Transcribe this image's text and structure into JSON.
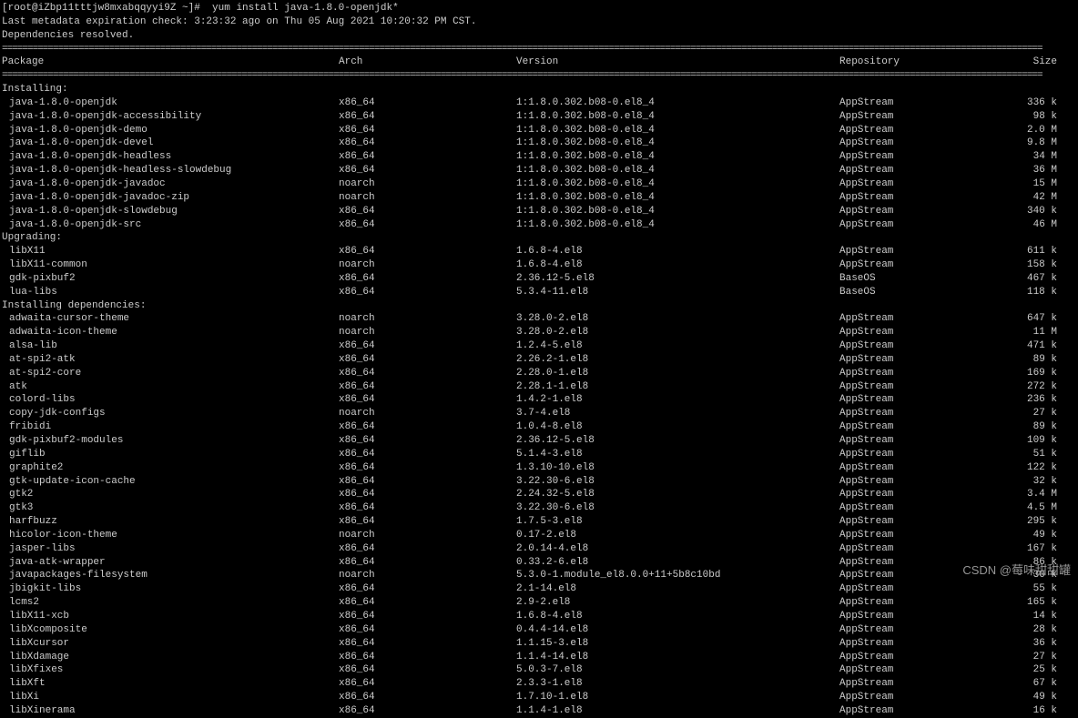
{
  "prompt": "[root@iZbp11tttjw8mxabqqyyi9Z ~]#  yum install java-1.8.0-openjdk*",
  "meta_line": "Last metadata expiration check: 3:23:32 ago on Thu 05 Aug 2021 10:20:32 PM CST.",
  "resolved_line": "Dependencies resolved.",
  "headers": {
    "package": "Package",
    "arch": "Arch",
    "version": "Version",
    "repo": "Repository",
    "size": "Size"
  },
  "sections": [
    {
      "label": "Installing:",
      "rows": [
        {
          "name": "java-1.8.0-openjdk",
          "arch": "x86_64",
          "version": "1:1.8.0.302.b08-0.el8_4",
          "repo": "AppStream",
          "size": "336 k"
        },
        {
          "name": "java-1.8.0-openjdk-accessibility",
          "arch": "x86_64",
          "version": "1:1.8.0.302.b08-0.el8_4",
          "repo": "AppStream",
          "size": "98 k"
        },
        {
          "name": "java-1.8.0-openjdk-demo",
          "arch": "x86_64",
          "version": "1:1.8.0.302.b08-0.el8_4",
          "repo": "AppStream",
          "size": "2.0 M"
        },
        {
          "name": "java-1.8.0-openjdk-devel",
          "arch": "x86_64",
          "version": "1:1.8.0.302.b08-0.el8_4",
          "repo": "AppStream",
          "size": "9.8 M"
        },
        {
          "name": "java-1.8.0-openjdk-headless",
          "arch": "x86_64",
          "version": "1:1.8.0.302.b08-0.el8_4",
          "repo": "AppStream",
          "size": "34 M"
        },
        {
          "name": "java-1.8.0-openjdk-headless-slowdebug",
          "arch": "x86_64",
          "version": "1:1.8.0.302.b08-0.el8_4",
          "repo": "AppStream",
          "size": "36 M"
        },
        {
          "name": "java-1.8.0-openjdk-javadoc",
          "arch": "noarch",
          "version": "1:1.8.0.302.b08-0.el8_4",
          "repo": "AppStream",
          "size": "15 M"
        },
        {
          "name": "java-1.8.0-openjdk-javadoc-zip",
          "arch": "noarch",
          "version": "1:1.8.0.302.b08-0.el8_4",
          "repo": "AppStream",
          "size": "42 M"
        },
        {
          "name": "java-1.8.0-openjdk-slowdebug",
          "arch": "x86_64",
          "version": "1:1.8.0.302.b08-0.el8_4",
          "repo": "AppStream",
          "size": "340 k"
        },
        {
          "name": "java-1.8.0-openjdk-src",
          "arch": "x86_64",
          "version": "1:1.8.0.302.b08-0.el8_4",
          "repo": "AppStream",
          "size": "46 M"
        }
      ]
    },
    {
      "label": "Upgrading:",
      "rows": [
        {
          "name": "libX11",
          "arch": "x86_64",
          "version": "1.6.8-4.el8",
          "repo": "AppStream",
          "size": "611 k"
        },
        {
          "name": "libX11-common",
          "arch": "noarch",
          "version": "1.6.8-4.el8",
          "repo": "AppStream",
          "size": "158 k"
        },
        {
          "name": "gdk-pixbuf2",
          "arch": "x86_64",
          "version": "2.36.12-5.el8",
          "repo": "BaseOS",
          "size": "467 k"
        },
        {
          "name": "lua-libs",
          "arch": "x86_64",
          "version": "5.3.4-11.el8",
          "repo": "BaseOS",
          "size": "118 k"
        }
      ]
    },
    {
      "label": "Installing dependencies:",
      "rows": [
        {
          "name": "adwaita-cursor-theme",
          "arch": "noarch",
          "version": "3.28.0-2.el8",
          "repo": "AppStream",
          "size": "647 k"
        },
        {
          "name": "adwaita-icon-theme",
          "arch": "noarch",
          "version": "3.28.0-2.el8",
          "repo": "AppStream",
          "size": "11 M"
        },
        {
          "name": "alsa-lib",
          "arch": "x86_64",
          "version": "1.2.4-5.el8",
          "repo": "AppStream",
          "size": "471 k"
        },
        {
          "name": "at-spi2-atk",
          "arch": "x86_64",
          "version": "2.26.2-1.el8",
          "repo": "AppStream",
          "size": "89 k"
        },
        {
          "name": "at-spi2-core",
          "arch": "x86_64",
          "version": "2.28.0-1.el8",
          "repo": "AppStream",
          "size": "169 k"
        },
        {
          "name": "atk",
          "arch": "x86_64",
          "version": "2.28.1-1.el8",
          "repo": "AppStream",
          "size": "272 k"
        },
        {
          "name": "colord-libs",
          "arch": "x86_64",
          "version": "1.4.2-1.el8",
          "repo": "AppStream",
          "size": "236 k"
        },
        {
          "name": "copy-jdk-configs",
          "arch": "noarch",
          "version": "3.7-4.el8",
          "repo": "AppStream",
          "size": "27 k"
        },
        {
          "name": "fribidi",
          "arch": "x86_64",
          "version": "1.0.4-8.el8",
          "repo": "AppStream",
          "size": "89 k"
        },
        {
          "name": "gdk-pixbuf2-modules",
          "arch": "x86_64",
          "version": "2.36.12-5.el8",
          "repo": "AppStream",
          "size": "109 k"
        },
        {
          "name": "giflib",
          "arch": "x86_64",
          "version": "5.1.4-3.el8",
          "repo": "AppStream",
          "size": "51 k"
        },
        {
          "name": "graphite2",
          "arch": "x86_64",
          "version": "1.3.10-10.el8",
          "repo": "AppStream",
          "size": "122 k"
        },
        {
          "name": "gtk-update-icon-cache",
          "arch": "x86_64",
          "version": "3.22.30-6.el8",
          "repo": "AppStream",
          "size": "32 k"
        },
        {
          "name": "gtk2",
          "arch": "x86_64",
          "version": "2.24.32-5.el8",
          "repo": "AppStream",
          "size": "3.4 M"
        },
        {
          "name": "gtk3",
          "arch": "x86_64",
          "version": "3.22.30-6.el8",
          "repo": "AppStream",
          "size": "4.5 M"
        },
        {
          "name": "harfbuzz",
          "arch": "x86_64",
          "version": "1.7.5-3.el8",
          "repo": "AppStream",
          "size": "295 k"
        },
        {
          "name": "hicolor-icon-theme",
          "arch": "noarch",
          "version": "0.17-2.el8",
          "repo": "AppStream",
          "size": "49 k"
        },
        {
          "name": "jasper-libs",
          "arch": "x86_64",
          "version": "2.0.14-4.el8",
          "repo": "AppStream",
          "size": "167 k"
        },
        {
          "name": "java-atk-wrapper",
          "arch": "x86_64",
          "version": "0.33.2-6.el8",
          "repo": "AppStream",
          "size": "86 k"
        },
        {
          "name": "javapackages-filesystem",
          "arch": "noarch",
          "version": "5.3.0-1.module_el8.0.0+11+5b8c10bd",
          "repo": "AppStream",
          "size": "30 k"
        },
        {
          "name": "jbigkit-libs",
          "arch": "x86_64",
          "version": "2.1-14.el8",
          "repo": "AppStream",
          "size": "55 k"
        },
        {
          "name": "lcms2",
          "arch": "x86_64",
          "version": "2.9-2.el8",
          "repo": "AppStream",
          "size": "165 k"
        },
        {
          "name": "libX11-xcb",
          "arch": "x86_64",
          "version": "1.6.8-4.el8",
          "repo": "AppStream",
          "size": "14 k"
        },
        {
          "name": "libXcomposite",
          "arch": "x86_64",
          "version": "0.4.4-14.el8",
          "repo": "AppStream",
          "size": "28 k"
        },
        {
          "name": "libXcursor",
          "arch": "x86_64",
          "version": "1.1.15-3.el8",
          "repo": "AppStream",
          "size": "36 k"
        },
        {
          "name": "libXdamage",
          "arch": "x86_64",
          "version": "1.1.4-14.el8",
          "repo": "AppStream",
          "size": "27 k"
        },
        {
          "name": "libXfixes",
          "arch": "x86_64",
          "version": "5.0.3-7.el8",
          "repo": "AppStream",
          "size": "25 k"
        },
        {
          "name": "libXft",
          "arch": "x86_64",
          "version": "2.3.3-1.el8",
          "repo": "AppStream",
          "size": "67 k"
        },
        {
          "name": "libXi",
          "arch": "x86_64",
          "version": "1.7.10-1.el8",
          "repo": "AppStream",
          "size": "49 k"
        },
        {
          "name": "libXinerama",
          "arch": "x86_64",
          "version": "1.1.4-1.el8",
          "repo": "AppStream",
          "size": "16 k"
        }
      ]
    }
  ],
  "watermark": "CSDN @莓味甜甜罐"
}
